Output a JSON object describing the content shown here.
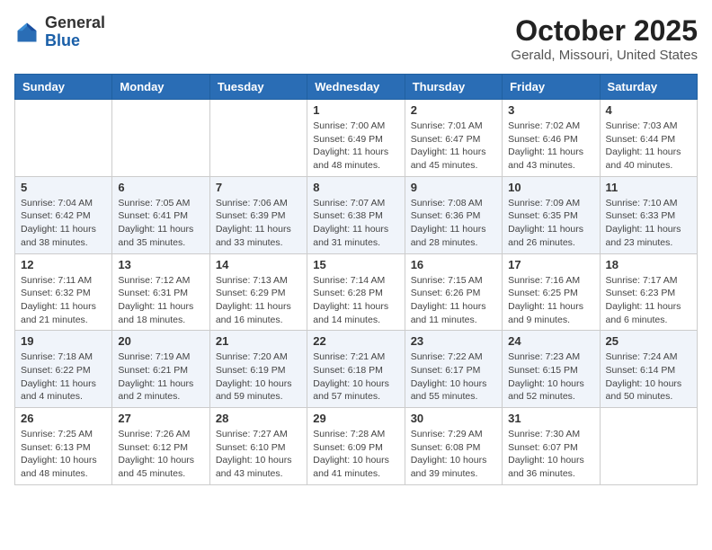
{
  "logo": {
    "general": "General",
    "blue": "Blue"
  },
  "title": "October 2025",
  "location": "Gerald, Missouri, United States",
  "days_header": [
    "Sunday",
    "Monday",
    "Tuesday",
    "Wednesday",
    "Thursday",
    "Friday",
    "Saturday"
  ],
  "weeks": [
    [
      {
        "day": "",
        "info": ""
      },
      {
        "day": "",
        "info": ""
      },
      {
        "day": "",
        "info": ""
      },
      {
        "day": "1",
        "info": "Sunrise: 7:00 AM\nSunset: 6:49 PM\nDaylight: 11 hours\nand 48 minutes."
      },
      {
        "day": "2",
        "info": "Sunrise: 7:01 AM\nSunset: 6:47 PM\nDaylight: 11 hours\nand 45 minutes."
      },
      {
        "day": "3",
        "info": "Sunrise: 7:02 AM\nSunset: 6:46 PM\nDaylight: 11 hours\nand 43 minutes."
      },
      {
        "day": "4",
        "info": "Sunrise: 7:03 AM\nSunset: 6:44 PM\nDaylight: 11 hours\nand 40 minutes."
      }
    ],
    [
      {
        "day": "5",
        "info": "Sunrise: 7:04 AM\nSunset: 6:42 PM\nDaylight: 11 hours\nand 38 minutes."
      },
      {
        "day": "6",
        "info": "Sunrise: 7:05 AM\nSunset: 6:41 PM\nDaylight: 11 hours\nand 35 minutes."
      },
      {
        "day": "7",
        "info": "Sunrise: 7:06 AM\nSunset: 6:39 PM\nDaylight: 11 hours\nand 33 minutes."
      },
      {
        "day": "8",
        "info": "Sunrise: 7:07 AM\nSunset: 6:38 PM\nDaylight: 11 hours\nand 31 minutes."
      },
      {
        "day": "9",
        "info": "Sunrise: 7:08 AM\nSunset: 6:36 PM\nDaylight: 11 hours\nand 28 minutes."
      },
      {
        "day": "10",
        "info": "Sunrise: 7:09 AM\nSunset: 6:35 PM\nDaylight: 11 hours\nand 26 minutes."
      },
      {
        "day": "11",
        "info": "Sunrise: 7:10 AM\nSunset: 6:33 PM\nDaylight: 11 hours\nand 23 minutes."
      }
    ],
    [
      {
        "day": "12",
        "info": "Sunrise: 7:11 AM\nSunset: 6:32 PM\nDaylight: 11 hours\nand 21 minutes."
      },
      {
        "day": "13",
        "info": "Sunrise: 7:12 AM\nSunset: 6:31 PM\nDaylight: 11 hours\nand 18 minutes."
      },
      {
        "day": "14",
        "info": "Sunrise: 7:13 AM\nSunset: 6:29 PM\nDaylight: 11 hours\nand 16 minutes."
      },
      {
        "day": "15",
        "info": "Sunrise: 7:14 AM\nSunset: 6:28 PM\nDaylight: 11 hours\nand 14 minutes."
      },
      {
        "day": "16",
        "info": "Sunrise: 7:15 AM\nSunset: 6:26 PM\nDaylight: 11 hours\nand 11 minutes."
      },
      {
        "day": "17",
        "info": "Sunrise: 7:16 AM\nSunset: 6:25 PM\nDaylight: 11 hours\nand 9 minutes."
      },
      {
        "day": "18",
        "info": "Sunrise: 7:17 AM\nSunset: 6:23 PM\nDaylight: 11 hours\nand 6 minutes."
      }
    ],
    [
      {
        "day": "19",
        "info": "Sunrise: 7:18 AM\nSunset: 6:22 PM\nDaylight: 11 hours\nand 4 minutes."
      },
      {
        "day": "20",
        "info": "Sunrise: 7:19 AM\nSunset: 6:21 PM\nDaylight: 11 hours\nand 2 minutes."
      },
      {
        "day": "21",
        "info": "Sunrise: 7:20 AM\nSunset: 6:19 PM\nDaylight: 10 hours\nand 59 minutes."
      },
      {
        "day": "22",
        "info": "Sunrise: 7:21 AM\nSunset: 6:18 PM\nDaylight: 10 hours\nand 57 minutes."
      },
      {
        "day": "23",
        "info": "Sunrise: 7:22 AM\nSunset: 6:17 PM\nDaylight: 10 hours\nand 55 minutes."
      },
      {
        "day": "24",
        "info": "Sunrise: 7:23 AM\nSunset: 6:15 PM\nDaylight: 10 hours\nand 52 minutes."
      },
      {
        "day": "25",
        "info": "Sunrise: 7:24 AM\nSunset: 6:14 PM\nDaylight: 10 hours\nand 50 minutes."
      }
    ],
    [
      {
        "day": "26",
        "info": "Sunrise: 7:25 AM\nSunset: 6:13 PM\nDaylight: 10 hours\nand 48 minutes."
      },
      {
        "day": "27",
        "info": "Sunrise: 7:26 AM\nSunset: 6:12 PM\nDaylight: 10 hours\nand 45 minutes."
      },
      {
        "day": "28",
        "info": "Sunrise: 7:27 AM\nSunset: 6:10 PM\nDaylight: 10 hours\nand 43 minutes."
      },
      {
        "day": "29",
        "info": "Sunrise: 7:28 AM\nSunset: 6:09 PM\nDaylight: 10 hours\nand 41 minutes."
      },
      {
        "day": "30",
        "info": "Sunrise: 7:29 AM\nSunset: 6:08 PM\nDaylight: 10 hours\nand 39 minutes."
      },
      {
        "day": "31",
        "info": "Sunrise: 7:30 AM\nSunset: 6:07 PM\nDaylight: 10 hours\nand 36 minutes."
      },
      {
        "day": "",
        "info": ""
      }
    ]
  ]
}
